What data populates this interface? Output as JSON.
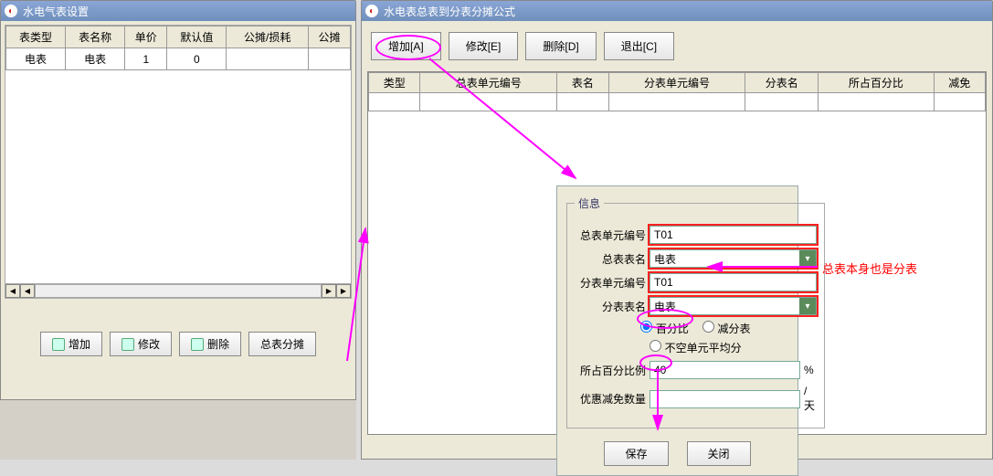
{
  "windows": {
    "left": {
      "title": "水电气表设置",
      "grid": {
        "headers": [
          "表类型",
          "表名称",
          "单价",
          "默认值",
          "公摊/损耗",
          "公摊"
        ],
        "row": [
          "电表",
          "电表",
          "1",
          "0",
          "",
          ""
        ]
      },
      "buttons": {
        "add": "增加",
        "edit": "修改",
        "del": "删除",
        "alloc": "总表分摊"
      }
    },
    "right": {
      "title": "水电表总表到分表分摊公式",
      "toolbar": {
        "add": "增加[A]",
        "edit": "修改[E]",
        "del": "删除[D]",
        "exit": "退出[C]"
      },
      "grid": {
        "headers": [
          "类型",
          "总表单元编号",
          "表名",
          "分表单元编号",
          "分表名",
          "所占百分比",
          "减免"
        ]
      }
    }
  },
  "modal": {
    "legend": "信息",
    "labels": {
      "main_unit": "总表单元编号",
      "main_name": "总表表名",
      "sub_unit": "分表单元编号",
      "sub_name": "分表表名",
      "percent": "所占百分比例",
      "discount": "优惠减免数量"
    },
    "values": {
      "main_unit": "T01",
      "main_name": "电表",
      "sub_unit": "T01",
      "sub_name": "电表",
      "percent": "40",
      "discount": ""
    },
    "radios": {
      "r1": "百分比",
      "r2": "减分表",
      "r3": "不空单元平均分"
    },
    "units": {
      "percent": "%",
      "discount": "/天"
    },
    "buttons": {
      "save": "保存",
      "close": "关闭"
    }
  },
  "annotation": {
    "text": "总表本身也是分表"
  }
}
